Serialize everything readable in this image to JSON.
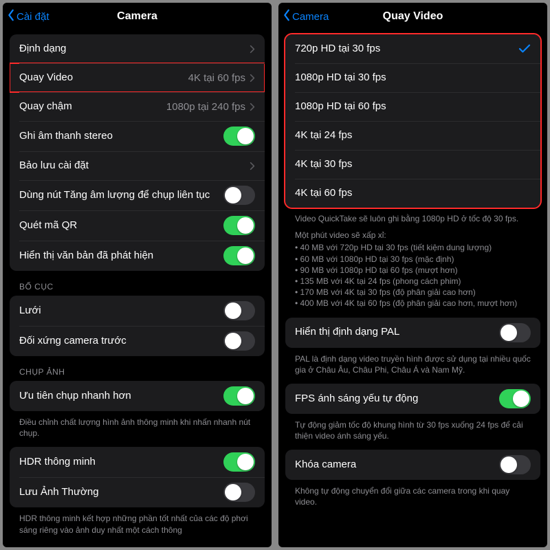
{
  "colors": {
    "accent": "#0a84ff",
    "toggle_on": "#30d158",
    "highlight": "#ff2a2a"
  },
  "left": {
    "back_label": "Cài đặt",
    "title": "Camera",
    "group1": [
      {
        "label": "Định dạng",
        "chevron": true
      },
      {
        "label": "Quay Video",
        "detail": "4K tại 60 fps",
        "chevron": true,
        "highlight": true
      },
      {
        "label": "Quay chậm",
        "detail": "1080p tại 240 fps",
        "chevron": true
      },
      {
        "label": "Ghi âm thanh stereo",
        "toggle": true
      },
      {
        "label": "Bảo lưu cài đặt",
        "chevron": true
      },
      {
        "label": "Dùng nút Tăng âm lượng để chụp liên tục",
        "toggle": false
      },
      {
        "label": "Quét mã QR",
        "toggle": true
      },
      {
        "label": "Hiển thị văn bản đã phát hiện",
        "toggle": true
      }
    ],
    "section_layout": "BỐ CỤC",
    "group_layout": [
      {
        "label": "Lưới",
        "toggle": false
      },
      {
        "label": "Đối xứng camera trước",
        "toggle": false
      }
    ],
    "section_capture": "CHỤP ẢNH",
    "group_capture": [
      {
        "label": "Ưu tiên chụp nhanh hơn",
        "toggle": true
      }
    ],
    "capture_footer": "Điều chỉnh chất lượng hình ảnh thông minh khi nhấn nhanh nút chụp.",
    "group_hdr": [
      {
        "label": "HDR thông minh",
        "toggle": true
      },
      {
        "label": "Lưu Ảnh Thường",
        "toggle": false
      }
    ],
    "hdr_footer": "HDR thông minh kết hợp những phần tốt nhất của các độ phơi sáng riêng vào ảnh duy nhất một cách thông"
  },
  "right": {
    "back_label": "Camera",
    "title": "Quay Video",
    "options": [
      {
        "label": "720p HD tại 30 fps",
        "selected": true
      },
      {
        "label": "1080p HD tại 30 fps"
      },
      {
        "label": "1080p HD tại 60 fps"
      },
      {
        "label": "4K tại 24 fps"
      },
      {
        "label": "4K tại 30 fps"
      },
      {
        "label": "4K tại 60 fps"
      }
    ],
    "quicktake_note": "Video QuickTake sẽ luôn ghi bằng 1080p HD ở tốc độ 30 fps.",
    "minute_intro": "Một phút video sẽ xấp xỉ:",
    "minute_lines": [
      "40 MB với 720p HD tại 30 fps (tiết kiệm dung lượng)",
      "60 MB với 1080p HD tại 30 fps (mặc định)",
      "90 MB với 1080p HD tại 60 fps (mượt hơn)",
      "135 MB với 4K tại 24 fps (phong cách phim)",
      "170 MB với 4K tại 30 fps (độ phân giải cao hơn)",
      "400 MB với 4K tại 60 fps (độ phân giải cao hơn, mượt hơn)"
    ],
    "pal": {
      "label": "Hiển thị định dạng PAL",
      "toggle": false
    },
    "pal_footer": "PAL là định dạng video truyền hình được sử dụng tại nhiều quốc gia ở Châu Âu, Châu Phi, Châu Á và Nam Mỹ.",
    "auto_fps": {
      "label": "FPS ánh sáng yếu tự động",
      "toggle": true
    },
    "auto_fps_footer": "Tự động giảm tốc độ khung hình từ 30 fps xuống 24 fps để cải thiện video ánh sáng yếu.",
    "lock": {
      "label": "Khóa camera",
      "toggle": false
    },
    "lock_footer": "Không tự động chuyển đổi giữa các camera trong khi quay video."
  }
}
